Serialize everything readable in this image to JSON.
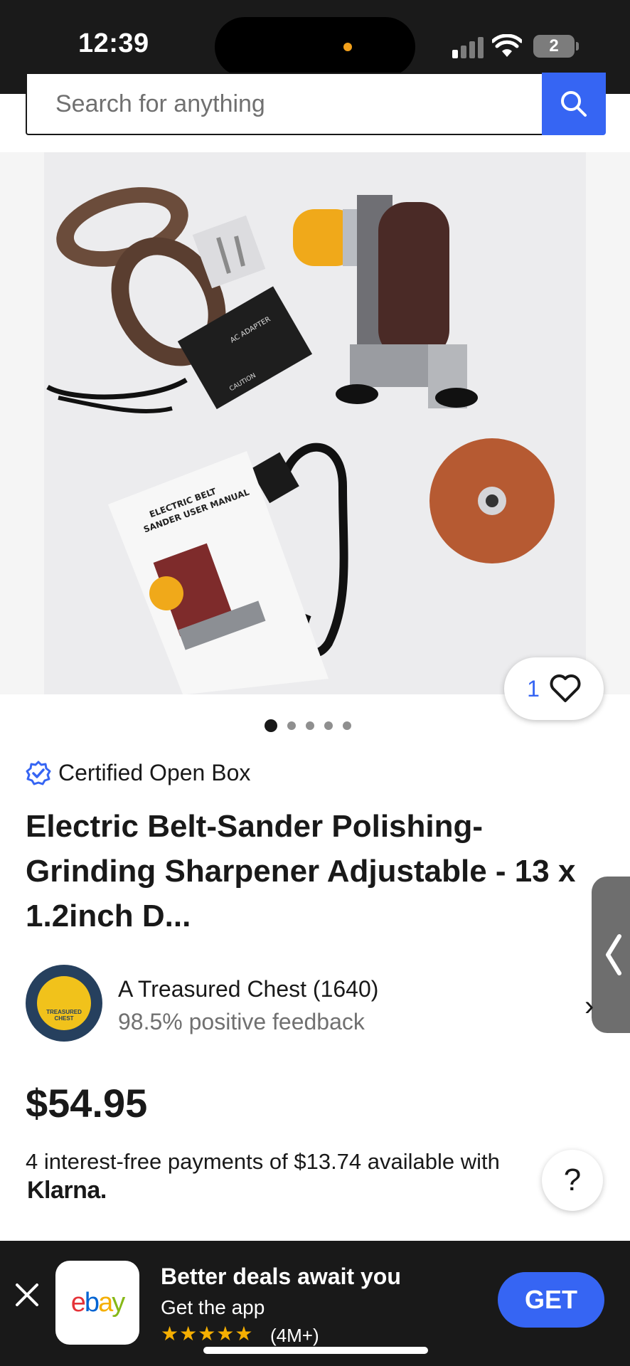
{
  "status_bar": {
    "time": "12:39",
    "battery": "2"
  },
  "search": {
    "placeholder": "Search for anything",
    "icon": "search-icon"
  },
  "gallery": {
    "image_count": 5,
    "active_index": 0,
    "watch_count": "1",
    "photo_text": {
      "manual_title_1": "ELECTRIC BELT",
      "manual_title_2": "SANDER USER MANUAL",
      "adapter_label": "AC ADAPTER",
      "caution_label": "CAUTION"
    }
  },
  "listing": {
    "condition": "Certified Open Box",
    "title": "Electric Belt-Sander Polishing-Grinding Sharpener Adjustable - 13 x 1.2inch D...",
    "seller": {
      "name": "A Treasured Chest (1640)",
      "feedback": "98.5% positive feedback",
      "avatar_line_1": "TREASURED",
      "avatar_line_2": "CHEST"
    },
    "price": "$54.95",
    "installments": "4 interest-free payments of $13.74 available with",
    "klarna": "Klarna.",
    "help": "?"
  },
  "app_banner": {
    "title": "Better deals await you",
    "subtitle": "Get the app",
    "stars": "★★★★★",
    "reviews": "(4M+)",
    "get": "GET",
    "logo": {
      "e": "e",
      "b": "b",
      "a": "a",
      "y": "y"
    }
  },
  "colors": {
    "accent": "#3665f3",
    "text": "#191919",
    "secondary_text": "#707070",
    "star": "#f5af02"
  }
}
